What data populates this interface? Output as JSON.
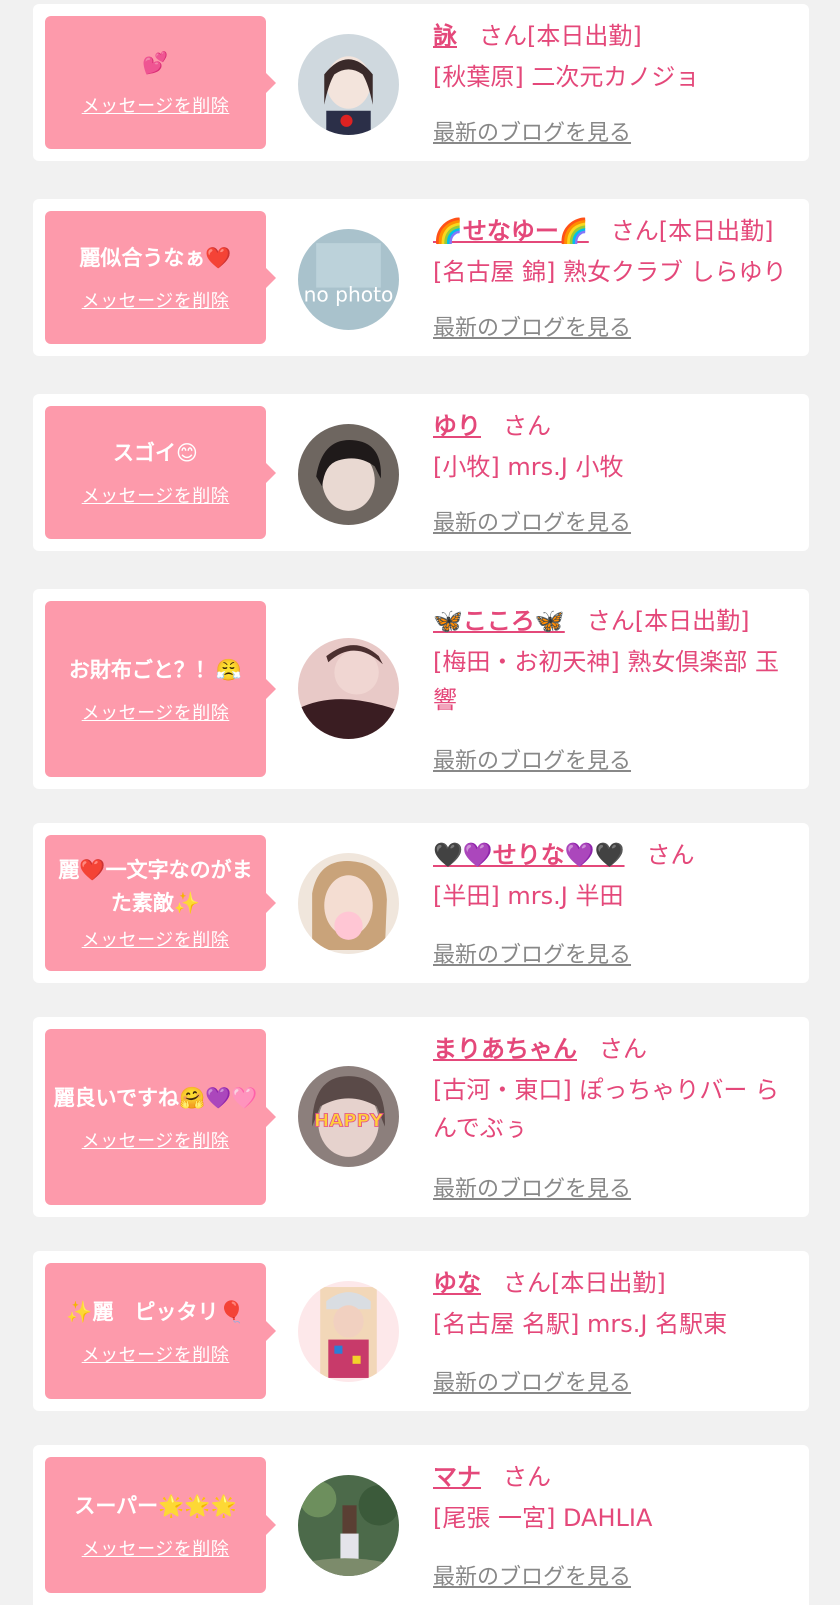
{
  "common": {
    "delete_label": "メッセージを削除",
    "blog_label": "最新のブログを見る",
    "san_suffix": "さん",
    "attendance": "[本日出勤]"
  },
  "colors": {
    "page_bg": "#f1f1f1",
    "bubble_bg": "#fd9aab",
    "accent": "#e4487a",
    "blog_link": "#888888"
  },
  "items": [
    {
      "message": "💕",
      "name": "詠",
      "suffix": "さん[本日出勤]",
      "shop": "[秋葉原] 二次元カノジョ",
      "avatar_icon": "avatar-photo-girl-uniform"
    },
    {
      "message": "麗似合うなぁ❤️",
      "name": "🌈せなゆー🌈",
      "suffix": "さん[本日出勤]",
      "shop": "[名古屋 錦] 熟女クラブ しらゆり",
      "avatar_icon": "avatar-no-photo",
      "avatar_text": "no photo"
    },
    {
      "message": "スゴイ😊",
      "name": "ゆり",
      "suffix": "さん",
      "shop": "[小牧] mrs.J 小牧",
      "avatar_icon": "avatar-photo-dark-hair"
    },
    {
      "message": "お財布ごと？！😤",
      "name": "🦋こころ🦋",
      "suffix": "さん[本日出勤]",
      "shop": "[梅田・お初天神] 熟女倶楽部 玉響",
      "avatar_icon": "avatar-photo-woman"
    },
    {
      "message": "麗❤️一文字なのがまた素敵✨",
      "name": "🖤💜せりな💜🖤",
      "suffix": "さん",
      "shop": "[半田] mrs.J 半田",
      "avatar_icon": "avatar-photo-blonde"
    },
    {
      "message": "麗良いですね🤗💜🩷",
      "name": "まりあちゃん",
      "suffix": "さん",
      "shop": "[古河・東口] ぽっちゃりバー らんでぶぅ",
      "avatar_icon": "avatar-photo-happy-sticker",
      "avatar_text": "HAPPY"
    },
    {
      "message": "✨麗　ピッタリ🎈",
      "name": "ゆな",
      "suffix": "さん[本日出勤]",
      "shop": "[名古屋 名駅] mrs.J 名駅東",
      "avatar_icon": "avatar-photo-cap"
    },
    {
      "message": "スーパー🌟🌟🌟",
      "name": "マナ",
      "suffix": "さん",
      "shop": "[尾張 一宮] DAHLIA",
      "avatar_icon": "avatar-photo-forest"
    }
  ]
}
